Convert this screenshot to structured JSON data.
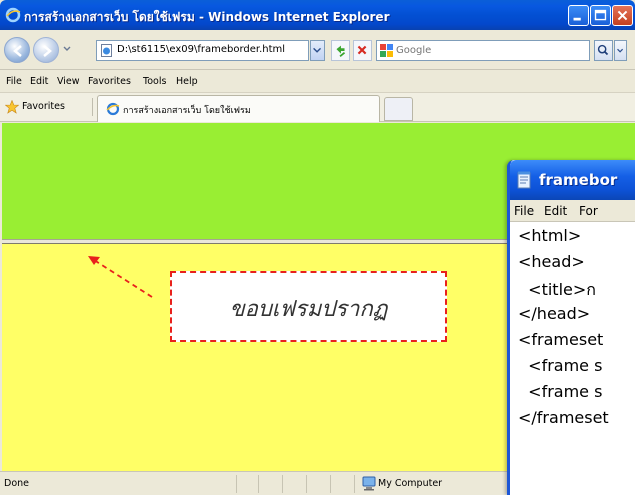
{
  "browser": {
    "window_title": "การสร้างเอกสารเว็บ โดยใช้เฟรม - Windows Internet Explorer",
    "address": "D:\\st6115\\ex09\\frameborder.html",
    "search_placeholder": "Google",
    "menu": [
      "File",
      "Edit",
      "View",
      "Favorites",
      "Tools",
      "Help"
    ],
    "favorites_label": "Favorites",
    "tab_title": "การสร้างเอกสารเว็บ โดยใช้เฟรม",
    "status_text": "Done",
    "security_zone": "My Computer",
    "colors": {
      "top_frame": "#99ee33",
      "bottom_frame": "#ffff66"
    }
  },
  "annotation": {
    "label": "ขอบเฟรมปรากฏ",
    "color": "#e8211c"
  },
  "notepad": {
    "title": "framebor",
    "menu": [
      "File",
      "Edit",
      "For"
    ],
    "lines": [
      "<html>",
      "<head>",
      "  <title>ก",
      "</head>",
      "<frameset",
      "  <frame s",
      "  <frame s",
      "</frameset"
    ]
  }
}
